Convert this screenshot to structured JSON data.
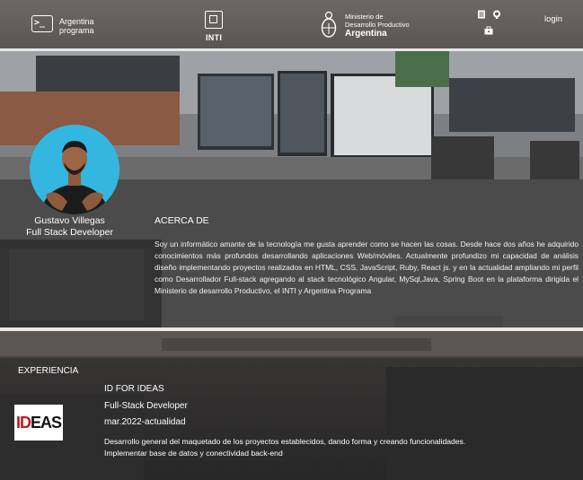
{
  "header": {
    "brand_line1": "Argentina",
    "brand_line2": "programa",
    "inti": "INTI",
    "ministry_line1": "Ministerio de",
    "ministry_line2": "Desarrollo Productivo",
    "ministry_line3": "Argentina",
    "icons": [
      "document-icon",
      "github-icon",
      "briefcase-icon"
    ],
    "login": "login"
  },
  "profile": {
    "name": "Gustavo Villegas",
    "role": "Full Stack Developer",
    "accent_color": "#33b7e0"
  },
  "about": {
    "title": "ACERCA DE",
    "text": "Soy un informático amante de la tecnología me gusta aprender como se hacen las cosas. Desde hace dos años he adquirido conocimientos más profundos desarrollando aplicaciones Web/móviles. Actualmente profundizo mi capacidad de análisis diseño implementando proyectos realizados en HTML, CSS, JavaScript, Ruby, React js. y en la actualidad ampliando mi perfil como Desarrollador Full-stack agregando al stack tecnológico Angular, MySql,Java, Spring Boot en la plataforma dirigida el Ministerio de desarrollo Productivo, el INTI y Argentina Programa"
  },
  "experience": {
    "title": "EXPERIENCIA",
    "items": [
      {
        "logo_text_a": "ID",
        "logo_text_b": "EAS",
        "company": "ID FOR IDEAS",
        "position": "Full-Stack Developer",
        "period": "mar.2022-actualidad",
        "description_line1": "Desarrollo general del maquetado de los proyectos establecidos, dando forma y creando funcionalidades.",
        "description_line2": "Implementar base de datos y conectividad back-end"
      }
    ]
  }
}
